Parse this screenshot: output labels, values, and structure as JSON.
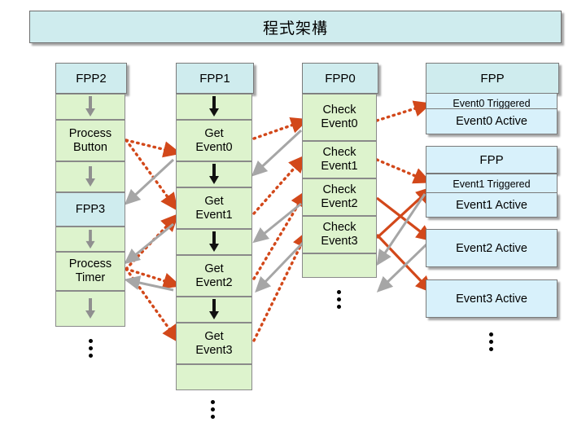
{
  "title": "程式架構",
  "columns": [
    {
      "id": "fpp2",
      "label": "FPP2"
    },
    {
      "id": "fpp1",
      "label": "FPP1"
    },
    {
      "id": "fpp0",
      "label": "FPP0"
    },
    {
      "id": "fpp",
      "label": "FPP"
    }
  ],
  "col_fpp2": {
    "items": [
      {
        "type": "arrow"
      },
      {
        "type": "text",
        "label": "Process\nButton"
      },
      {
        "type": "arrow"
      },
      {
        "type": "text",
        "label": "FPP3",
        "style": "blue"
      },
      {
        "type": "arrow"
      },
      {
        "type": "text",
        "label": "Process\nTimer"
      },
      {
        "type": "arrow"
      },
      {
        "type": "dots"
      }
    ]
  },
  "col_fpp1": {
    "items": [
      {
        "type": "arrow"
      },
      {
        "type": "text",
        "label": "Get\nEvent0"
      },
      {
        "type": "arrow"
      },
      {
        "type": "text",
        "label": "Get\nEvent1"
      },
      {
        "type": "arrow"
      },
      {
        "type": "text",
        "label": "Get\nEvent2"
      },
      {
        "type": "arrow"
      },
      {
        "type": "text",
        "label": "Get\nEvent3"
      },
      {
        "type": "blank"
      },
      {
        "type": "dots"
      }
    ]
  },
  "col_fpp0": {
    "items": [
      {
        "type": "text",
        "label": "Check\nEvent0"
      },
      {
        "type": "text",
        "label": "Check\nEvent1"
      },
      {
        "type": "text",
        "label": "Check\nEvent2"
      },
      {
        "type": "text",
        "label": "Check\nEvent3"
      },
      {
        "type": "blank"
      },
      {
        "type": "dots"
      }
    ]
  },
  "col_fpp_right": {
    "groups": [
      {
        "header": "FPP",
        "rows": [
          "Event0 Triggered",
          "Event0 Active"
        ]
      },
      {
        "header": "FPP",
        "rows": [
          "Event1 Triggered",
          "Event1 Active"
        ]
      },
      {
        "standalone": [
          "Event2 Active",
          "Event3 Active"
        ]
      }
    ],
    "dots": true
  },
  "colors": {
    "title_bg": "#cfecee",
    "cell_green": "#ddf3cd",
    "box_blue": "#d8f1fb",
    "arrow_gray": "#a6a6a6",
    "connector_red": "#d2481a",
    "border": "#7a7a7a"
  }
}
